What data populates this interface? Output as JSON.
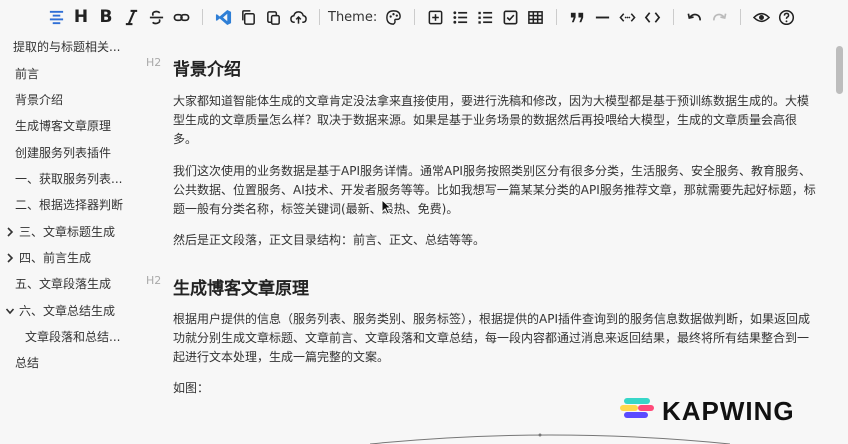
{
  "toolbar": {
    "theme_label": "Theme:",
    "bold_glyph": "B",
    "heading_glyph": "H"
  },
  "sidebar": {
    "items": [
      {
        "label": "提取的与标题相关..."
      },
      {
        "label": "前言"
      },
      {
        "label": "背景介绍"
      },
      {
        "label": "生成博客文章原理"
      },
      {
        "label": "创建服务列表插件"
      },
      {
        "label": "一、获取服务列表..."
      },
      {
        "label": "二、根据选择器判断"
      },
      {
        "label": "三、文章标题生成"
      },
      {
        "label": "四、前言生成"
      },
      {
        "label": "五、文章段落生成"
      },
      {
        "label": "六、文章总结生成"
      },
      {
        "label": "文章段落和总结..."
      },
      {
        "label": "总结"
      }
    ]
  },
  "content": {
    "h2_tag": "H2",
    "section1_title": "背景介绍",
    "section1_p1": "大家都知道智能体生成的文章肯定没法拿来直接使用，要进行洗稿和修改，因为大模型都是基于预训练数据生成的。大模型生成的文章质量怎么样？取决于数据来源。如果是基于业务场景的数据然后再投喂给大模型，生成的文章质量会高很多。",
    "section1_p2": "我们这次使用的业务数据是基于API服务详情。通常API服务按照类别区分有很多分类，生活服务、安全服务、教育服务、公共数据、位置服务、AI技术、开发者服务等等。比如我想写一篇某某分类的API服务推荐文章，那就需要先起好标题，标题一般有分类名称，标签关键词(最新、最热、免费)。",
    "section1_p3": "然后是正文段落，正文目录结构：前言、正文、总结等等。",
    "section2_title": "生成博客文章原理",
    "section2_p1": "根据用户提供的信息（服务列表、服务类别、服务标签），根据提供的API插件查询到的服务信息数据做判断，如果返回成功就分别生成文章标题、文章前言、文章段落和文章总结，每一段内容都通过消息来返回结果，最终将所有结果整合到一起进行文本处理，生成一篇完整的文案。",
    "section2_p2": "如图："
  },
  "watermark": {
    "text": "KAPWING",
    "colors": [
      "#37d6c8",
      "#ffd84d",
      "#ff4a7a",
      "#5a4bff"
    ]
  }
}
